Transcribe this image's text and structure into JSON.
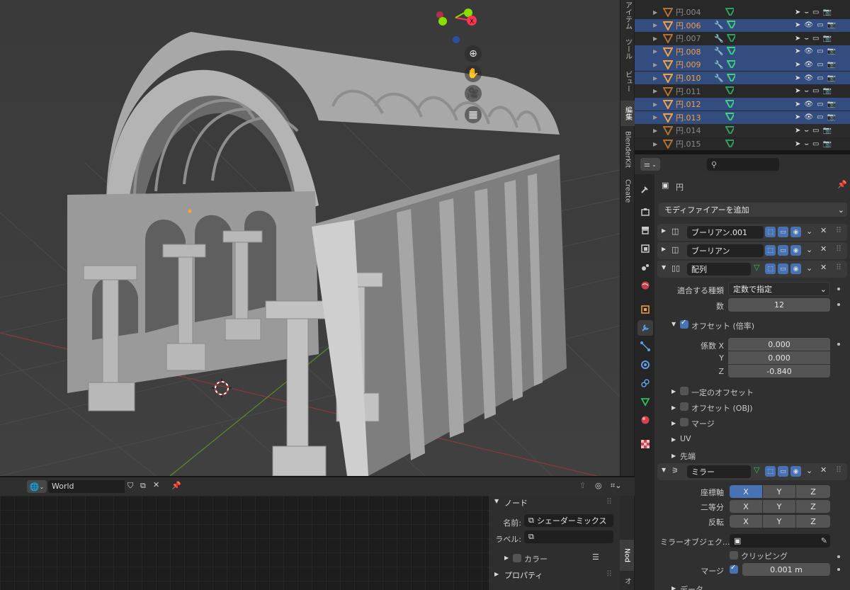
{
  "viewport": {
    "nav_buttons": [
      {
        "name": "zoom-icon",
        "glyph": "⊕"
      },
      {
        "name": "hand-pan-icon",
        "glyph": "✋"
      },
      {
        "name": "camera-icon",
        "glyph": "🎥"
      },
      {
        "name": "grid-icon",
        "glyph": "▦"
      }
    ],
    "gizmo_colors": {
      "x": "#ff3352",
      "y": "#8bdc00",
      "z": "#2890ff"
    },
    "gizmo_axis_label": "X"
  },
  "n_panel_tabs": [
    {
      "label": "アイテム",
      "active": false
    },
    {
      "label": "ツール",
      "active": false
    },
    {
      "label": "ビュー",
      "active": false
    },
    {
      "label": "編集",
      "active": true
    },
    {
      "label": "BlenderKit",
      "active": false
    },
    {
      "label": "Create",
      "active": false
    }
  ],
  "outliner": {
    "rows": [
      {
        "name": "円.004",
        "selected": false,
        "modifier": false
      },
      {
        "name": "円.006",
        "selected": true,
        "modifier": true
      },
      {
        "name": "円.007",
        "selected": false,
        "modifier": true
      },
      {
        "name": "円.008",
        "selected": true,
        "modifier": true
      },
      {
        "name": "円.009",
        "selected": true,
        "modifier": true
      },
      {
        "name": "円.010",
        "selected": true,
        "modifier": true
      },
      {
        "name": "円.011",
        "selected": false,
        "modifier": false
      },
      {
        "name": "円.012",
        "selected": true,
        "modifier": false
      },
      {
        "name": "円.013",
        "selected": true,
        "modifier": false
      },
      {
        "name": "円.014",
        "selected": false,
        "modifier": false
      },
      {
        "name": "円.015",
        "selected": false,
        "modifier": false
      }
    ]
  },
  "properties": {
    "search_placeholder": "",
    "object_name": "円",
    "add_modifier": "モディファイアーを追加",
    "modifiers": [
      {
        "name": "ブーリアン.001",
        "expanded": false
      },
      {
        "name": "ブーリアン",
        "expanded": false
      },
      {
        "name": "配列",
        "expanded": true
      }
    ],
    "array": {
      "fit_type_label": "適合する種類",
      "fit_type_value": "定数で指定",
      "count_label": "数",
      "count_value": "12",
      "offset_relative": "オフセット (倍率)",
      "factor_x_label": "係数 X",
      "factor_x": "0.000",
      "y_label": "Y",
      "factor_y": "0.000",
      "z_label": "Z",
      "factor_z": "-0.840",
      "constant_offset": "一定のオフセット",
      "object_offset": "オフセット (OBJ)",
      "merge": "マージ",
      "uv": "UV",
      "caps": "先端"
    },
    "mirror": {
      "name": "ミラー",
      "axis_label": "座標軸",
      "bisect_label": "二等分",
      "flip_label": "反転",
      "axes": [
        "X",
        "Y",
        "Z"
      ],
      "mirror_object_label": "ミラーオブジェク...",
      "clipping_label": "クリッピング",
      "merge_label": "マージ",
      "merge_value": "0.001 m",
      "data_label": "データ"
    }
  },
  "shader": {
    "world_name": "World",
    "sidebar": {
      "node_header": "ノード",
      "name_label": "名前:",
      "name_value": "シェーダーミックス",
      "label_label": "ラベル:",
      "label_value": "",
      "color_label": "カラー",
      "properties_header": "プロパティ"
    },
    "tabs": [
      {
        "label": "Nod",
        "active": true
      },
      {
        "label": "オ",
        "active": false
      }
    ]
  },
  "colors": {
    "selected_row": "#334d80",
    "active_blue": "#4772b3",
    "orange_text": "#f0a040"
  }
}
